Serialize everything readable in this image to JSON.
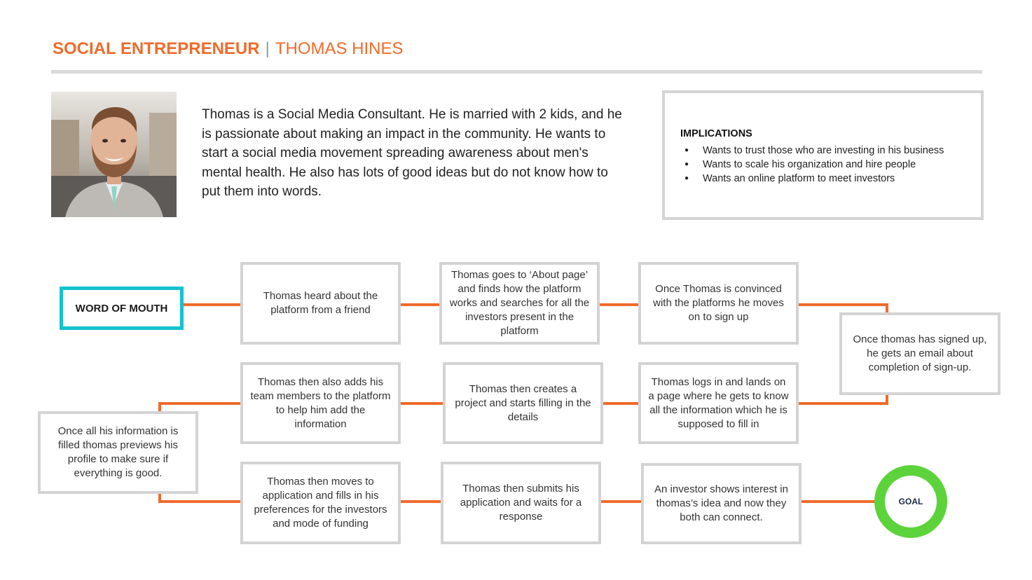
{
  "header": {
    "role": "SOCIAL ENTREPRENEUR",
    "separator": "|",
    "name": "THOMAS HINES"
  },
  "bio": "Thomas is a Social Media Consultant. He is married with 2 kids, and he is passionate about making an impact in the community. He wants to start a social media movement spreading awareness about men's mental health. He also has lots of good ideas but do not know how to put them into words.",
  "implications": {
    "title": "IMPLICATIONS",
    "items": [
      "Wants to trust those who are investing in his business",
      " Wants to scale his organization and hire people",
      "Wants an online platform to meet investors"
    ]
  },
  "flow": {
    "start": "WORD OF MOUTH",
    "steps": [
      "Thomas heard about the platform from a friend",
      "Thomas goes to ‘About page’ and finds how  the platform works and searches for all the investors present in the platform",
      "Once Thomas is convinced with the platforms he moves on to sign up",
      "Once thomas has signed up, he gets an email about completion of sign-up.",
      "Thomas logs in and lands on a page where he gets to know all the information which he is supposed to fill in",
      "Thomas then creates a project and starts filling in the details",
      "Thomas then also adds his team members to the platform to help him add the information",
      "Once all his information is filled thomas previews his profile to make sure if everything is good.",
      "Thomas then moves to application and fills in his preferences for the investors and mode of funding",
      "Thomas then submits his application and waits for a response",
      "An investor shows interest in thomas’s idea and now they both can connect."
    ],
    "goal": "GOAL"
  },
  "colors": {
    "accent_orange": "#ef6b2b",
    "start_border": "#14c3cf",
    "goal_green": "#5cd33a",
    "box_border": "#d3d3d3"
  }
}
